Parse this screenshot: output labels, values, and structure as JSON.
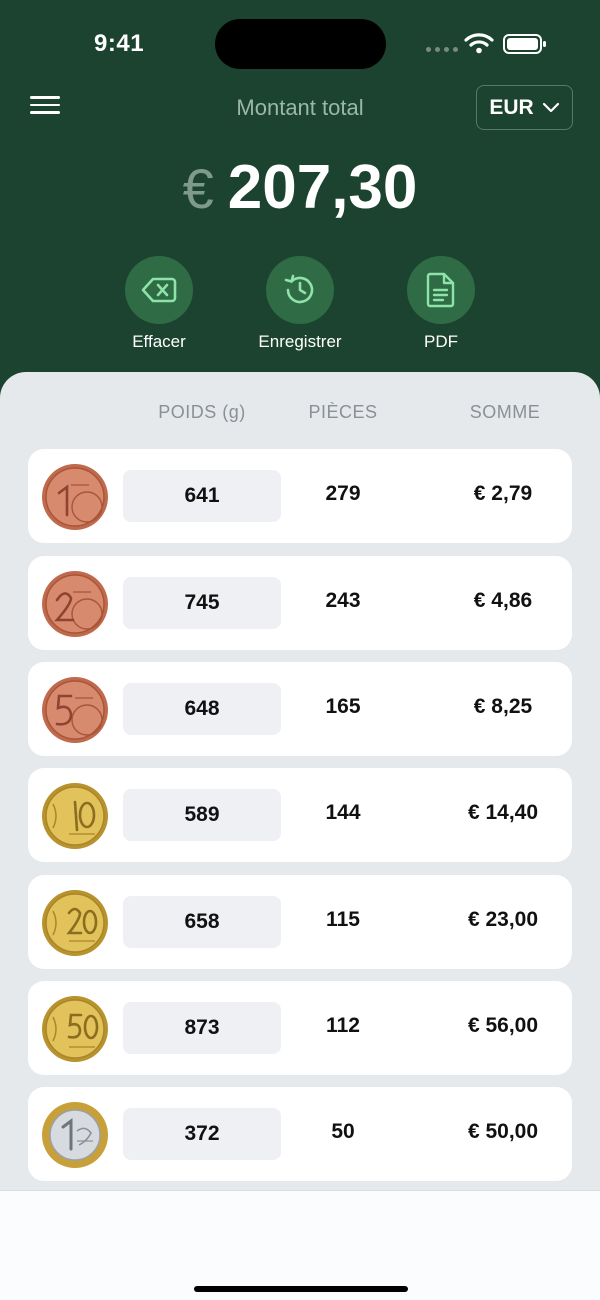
{
  "status_bar": {
    "time": "9:41"
  },
  "header": {
    "title": "Montant total",
    "currency_button": "EUR",
    "total_currency_symbol": "€",
    "total_value": "207,30"
  },
  "actions": [
    {
      "label": "Effacer",
      "icon": "backspace-icon"
    },
    {
      "label": "Enregistrer",
      "icon": "history-icon"
    },
    {
      "label": "PDF",
      "icon": "document-icon"
    }
  ],
  "columns": {
    "weight": "POIDS (g)",
    "pieces": "PIÈCES",
    "sum": "SOMME"
  },
  "coins": [
    {
      "coin": "1 cent coin",
      "weight": "641",
      "pieces": "279",
      "sum": "€ 2,79"
    },
    {
      "coin": "2 cent coin",
      "weight": "745",
      "pieces": "243",
      "sum": "€ 4,86"
    },
    {
      "coin": "5 cent coin",
      "weight": "648",
      "pieces": "165",
      "sum": "€ 8,25"
    },
    {
      "coin": "10 cent coin",
      "weight": "589",
      "pieces": "144",
      "sum": "€ 14,40"
    },
    {
      "coin": "20 cent coin",
      "weight": "658",
      "pieces": "115",
      "sum": "€ 23,00"
    },
    {
      "coin": "50 cent coin",
      "weight": "873",
      "pieces": "112",
      "sum": "€ 56,00"
    },
    {
      "coin": "1 euro coin",
      "weight": "372",
      "pieces": "50",
      "sum": "€ 50,00"
    }
  ],
  "colors": {
    "header_bg": "#1b4330",
    "action_circle": "#2f6b45",
    "action_icon": "#8fe3a8",
    "sheet_bg": "#e5e9ec",
    "copper": "#c06a4d",
    "gold": "#d9b441",
    "silver": "#cfd2d6"
  }
}
